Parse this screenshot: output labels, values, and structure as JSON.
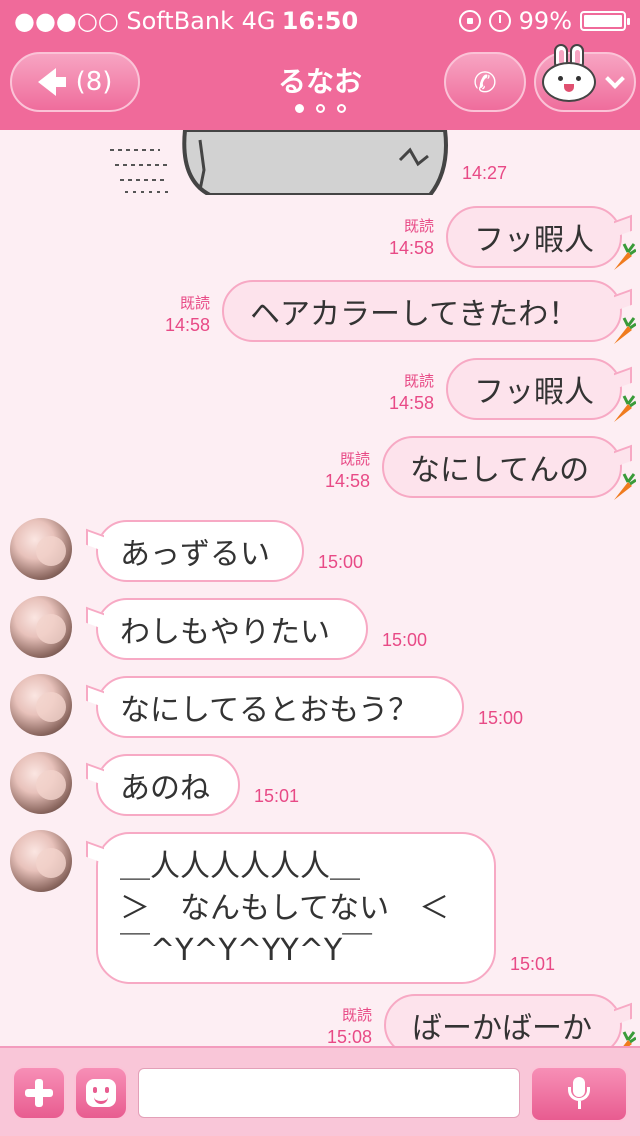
{
  "status_bar": {
    "carrier": "●●●○○ SoftBank   4G",
    "time": "16:50",
    "battery": "99%",
    "battery_level": 0.99
  },
  "header": {
    "back_count": "(8)",
    "title": "るなお",
    "page_dots": 3,
    "active_dot": 0,
    "call_icon": "phone-icon",
    "profile_icon": "bunny-sticker-icon"
  },
  "messages": [
    {
      "side": "in",
      "type": "sticker",
      "time": "14:27"
    },
    {
      "side": "out",
      "text": "フッ暇人",
      "read": "既読",
      "time": "14:58"
    },
    {
      "side": "out",
      "text": "ヘアカラーしてきたわ！",
      "read": "既読",
      "time": "14:58"
    },
    {
      "side": "out",
      "text": "フッ暇人",
      "read": "既読",
      "time": "14:58"
    },
    {
      "side": "out",
      "text": "なにしてんの",
      "read": "既読",
      "time": "14:58"
    },
    {
      "side": "in",
      "text": "あっずるい",
      "time": "15:00"
    },
    {
      "side": "in",
      "text": "わしもやりたい",
      "time": "15:00"
    },
    {
      "side": "in",
      "text": "なにしてるとおもう？",
      "time": "15:00"
    },
    {
      "side": "in",
      "text": "あのね",
      "time": "15:01"
    },
    {
      "side": "in",
      "lines": [
        "＿人人人人人人＿",
        "＞　なんもしてない　＜",
        "￣^Y^Y^YY^Y￣"
      ],
      "time": "15:01"
    },
    {
      "side": "out",
      "text": "ばーかばーか",
      "read": "既読",
      "time": "15:08"
    }
  ],
  "input_bar": {
    "plus_icon": "plus-icon",
    "emoji_icon": "emoji-icon",
    "text_value": "",
    "mic_icon": "microphone-icon"
  },
  "colors": {
    "header_pink": "#f06a9a",
    "chat_bg": "#fdeef3",
    "outgoing_bubble": "#fde3ec",
    "incoming_bubble": "#ffffff",
    "accent_text": "#e84a86"
  }
}
